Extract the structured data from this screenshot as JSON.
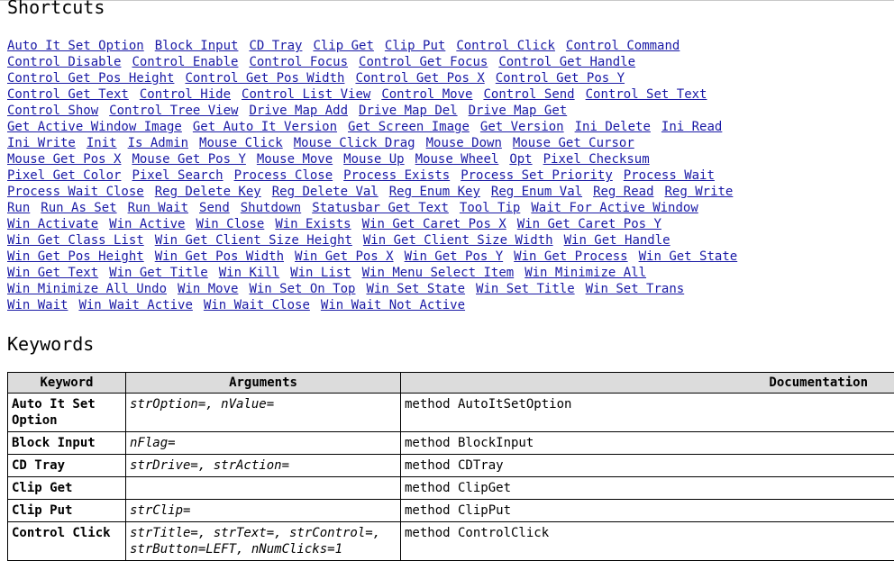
{
  "headings": {
    "shortcuts": "Shortcuts",
    "keywords": "Keywords"
  },
  "shortcut_lines": [
    [
      "Auto It Set Option",
      "Block Input",
      "CD Tray",
      "Clip Get",
      "Clip Put",
      "Control Click",
      "Control Command"
    ],
    [
      "Control Disable",
      "Control Enable",
      "Control Focus",
      "Control Get Focus",
      "Control Get Handle"
    ],
    [
      "Control Get Pos Height",
      "Control Get Pos Width",
      "Control Get Pos X",
      "Control Get Pos Y"
    ],
    [
      "Control Get Text",
      "Control Hide",
      "Control List View",
      "Control Move",
      "Control Send",
      "Control Set Text"
    ],
    [
      "Control Show",
      "Control Tree View",
      "Drive Map Add",
      "Drive Map Del",
      "Drive Map Get"
    ],
    [
      "Get Active Window Image",
      "Get Auto It Version",
      "Get Screen Image",
      "Get Version",
      "Ini Delete",
      "Ini Read"
    ],
    [
      "Ini Write",
      "Init",
      "Is Admin",
      "Mouse Click",
      "Mouse Click Drag",
      "Mouse Down",
      "Mouse Get Cursor"
    ],
    [
      "Mouse Get Pos X",
      "Mouse Get Pos Y",
      "Mouse Move",
      "Mouse Up",
      "Mouse Wheel",
      "Opt",
      "Pixel Checksum"
    ],
    [
      "Pixel Get Color",
      "Pixel Search",
      "Process Close",
      "Process Exists",
      "Process Set Priority",
      "Process Wait"
    ],
    [
      "Process Wait Close",
      "Reg Delete Key",
      "Reg Delete Val",
      "Reg Enum Key",
      "Reg Enum Val",
      "Reg Read",
      "Reg Write"
    ],
    [
      "Run",
      "Run As Set",
      "Run Wait",
      "Send",
      "Shutdown",
      "Statusbar Get Text",
      "Tool Tip",
      "Wait For Active Window"
    ],
    [
      "Win Activate",
      "Win Active",
      "Win Close",
      "Win Exists",
      "Win Get Caret Pos X",
      "Win Get Caret Pos Y"
    ],
    [
      "Win Get Class List",
      "Win Get Client Size Height",
      "Win Get Client Size Width",
      "Win Get Handle"
    ],
    [
      "Win Get Pos Height",
      "Win Get Pos Width",
      "Win Get Pos X",
      "Win Get Pos Y",
      "Win Get Process",
      "Win Get State"
    ],
    [
      "Win Get Text",
      "Win Get Title",
      "Win Kill",
      "Win List",
      "Win Menu Select Item",
      "Win Minimize All"
    ],
    [
      "Win Minimize All Undo",
      "Win Move",
      "Win Set On Top",
      "Win Set State",
      "Win Set Title",
      "Win Set Trans"
    ],
    [
      "Win Wait",
      "Win Wait Active",
      "Win Wait Close",
      "Win Wait Not Active"
    ]
  ],
  "table": {
    "headers": {
      "keyword": "Keyword",
      "arguments": "Arguments",
      "documentation": "Documentation"
    },
    "rows": [
      {
        "keyword": "Auto It Set Option",
        "arguments": "strOption=, nValue=",
        "documentation": "method AutoItSetOption"
      },
      {
        "keyword": "Block Input",
        "arguments": "nFlag=",
        "documentation": "method BlockInput"
      },
      {
        "keyword": "CD Tray",
        "arguments": "strDrive=, strAction=",
        "documentation": "method CDTray"
      },
      {
        "keyword": "Clip Get",
        "arguments": "",
        "documentation": "method ClipGet"
      },
      {
        "keyword": "Clip Put",
        "arguments": "strClip=",
        "documentation": "method ClipPut"
      },
      {
        "keyword": "Control Click",
        "arguments": "strTitle=, strText=, strControl=, strButton=LEFT, nNumClicks=1",
        "documentation": "method ControlClick"
      }
    ]
  },
  "colors": {
    "link": "#1a1aa6",
    "header_bg": "#dcdcdc"
  }
}
